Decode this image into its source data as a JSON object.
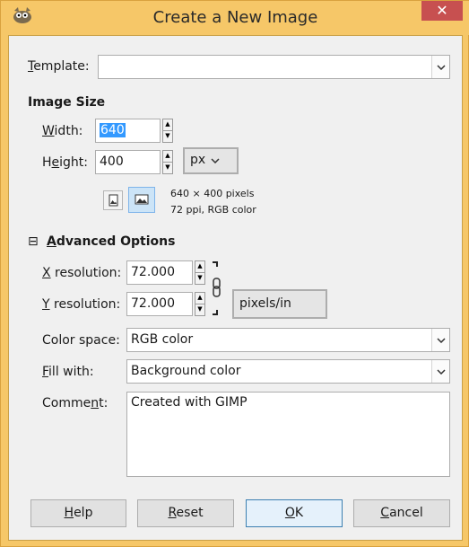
{
  "window": {
    "title": "Create a New Image",
    "close_label": "✕"
  },
  "template": {
    "label_u": "T",
    "label_rest": "emplate:",
    "value": ""
  },
  "image_size": {
    "heading": "Image Size",
    "width_label_u": "W",
    "width_label_rest": "idth:",
    "width_value": "640",
    "height_label_pre": "H",
    "height_label_u": "e",
    "height_label_rest": "ight:",
    "height_value": "400",
    "unit": "px",
    "info_line1": "640 × 400 pixels",
    "info_line2": "72 ppi, RGB color"
  },
  "advanced": {
    "toggle": "⊟",
    "heading_u": "A",
    "heading_rest": "dvanced Options",
    "xres_label_u": "X",
    "xres_label_rest": " resolution:",
    "xres_value": "72.000",
    "yres_label_u": "Y",
    "yres_label_rest": " resolution:",
    "yres_value": "72.000",
    "res_unit": "pixels/in",
    "color_space_label": "Color space:",
    "color_space_value": "RGB color",
    "fill_label_u": "F",
    "fill_label_rest": "ill with:",
    "fill_value": "Background color",
    "comment_label_pre": "Comme",
    "comment_label_u": "n",
    "comment_label_rest": "t:",
    "comment_value": "Created with GIMP"
  },
  "buttons": {
    "help_u": "H",
    "help_rest": "elp",
    "reset_u": "R",
    "reset_rest": "eset",
    "ok_u": "O",
    "ok_rest": "K",
    "cancel_u": "C",
    "cancel_rest": "ancel"
  },
  "icons": {
    "app": "gimp-wilber-icon",
    "portrait": "portrait-icon",
    "landscape": "landscape-icon",
    "chain": "chain-link-icon"
  }
}
